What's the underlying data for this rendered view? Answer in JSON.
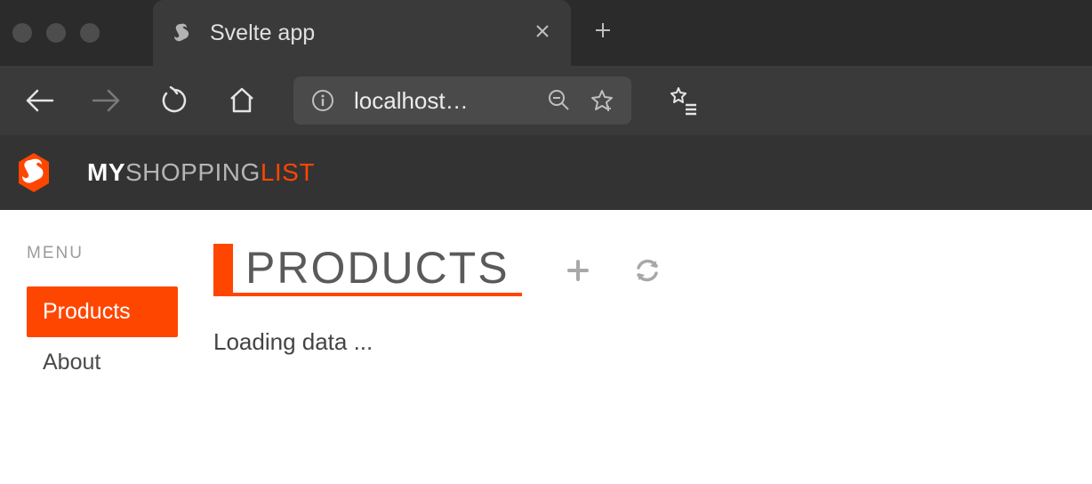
{
  "browser": {
    "tab_title": "Svelte app",
    "address_text": "localhost…"
  },
  "header": {
    "brand_part1": "MY",
    "brand_part2": "SHOPPING",
    "brand_part3": "LIST"
  },
  "sidebar": {
    "menu_label": "MENU",
    "items": [
      {
        "label": "Products",
        "active": true
      },
      {
        "label": "About",
        "active": false
      }
    ]
  },
  "main": {
    "heading": "PRODUCTS",
    "loading_text": "Loading data ..."
  }
}
